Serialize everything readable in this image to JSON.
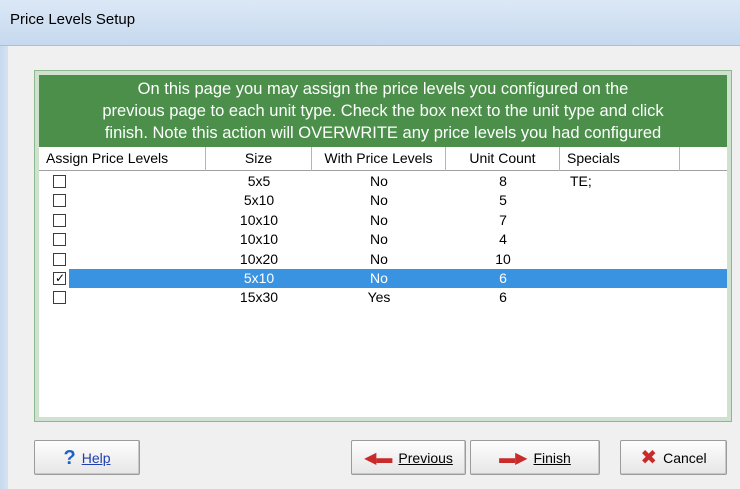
{
  "window": {
    "title": "Price Levels Setup"
  },
  "banner": {
    "lines": [
      "On this page you may assign the price levels you configured on the",
      "previous page to each unit type. Check the box next to the unit type and click",
      "finish. Note this action will OVERWRITE any price levels you had configured"
    ]
  },
  "table": {
    "headers": [
      "Assign Price Levels",
      "Size",
      "With Price Levels",
      "Unit Count",
      "Specials"
    ],
    "rows": [
      {
        "checked": false,
        "size": "5x5",
        "with_price_levels": "No",
        "unit_count": "8",
        "specials": "TE;"
      },
      {
        "checked": false,
        "size": "5x10",
        "with_price_levels": "No",
        "unit_count": "5",
        "specials": ""
      },
      {
        "checked": false,
        "size": "10x10",
        "with_price_levels": "No",
        "unit_count": "7",
        "specials": ""
      },
      {
        "checked": false,
        "size": "10x10",
        "with_price_levels": "No",
        "unit_count": "4",
        "specials": ""
      },
      {
        "checked": false,
        "size": "10x20",
        "with_price_levels": "No",
        "unit_count": "10",
        "specials": ""
      },
      {
        "checked": true,
        "size": "5x10",
        "with_price_levels": "No",
        "unit_count": "6",
        "specials": ""
      },
      {
        "checked": false,
        "size": "15x30",
        "with_price_levels": "Yes",
        "unit_count": "6",
        "specials": ""
      }
    ],
    "selected_row_color": "#3a93e0"
  },
  "buttons": {
    "help": {
      "label": "Help",
      "icon": "question-mark-icon"
    },
    "previous": {
      "label": "Previous",
      "icon": "left-arrow-icon"
    },
    "finish": {
      "label": "Finish",
      "icon": "right-arrow-icon"
    },
    "cancel": {
      "label": "Cancel",
      "icon": "x-icon"
    }
  },
  "colors": {
    "banner": "#4b8f4b",
    "panel_border": "#cfe2cf",
    "titlebar": "#cfdff1"
  }
}
